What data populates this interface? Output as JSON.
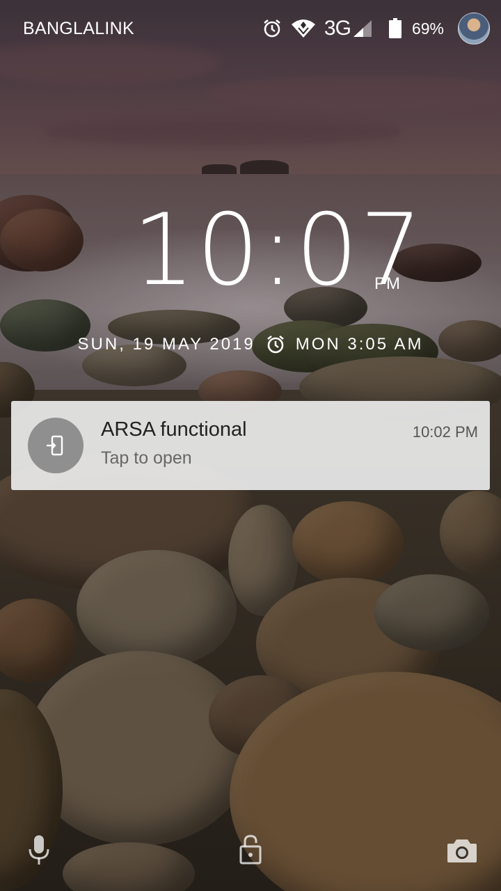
{
  "status_bar": {
    "carrier": "BANGLALINK",
    "network_type": "3G",
    "battery_percent": "69%",
    "icons": [
      "alarm-icon",
      "wifi-icon",
      "signal-icon",
      "battery-icon",
      "avatar"
    ]
  },
  "clock": {
    "time": "10:07",
    "ampm": "PM"
  },
  "date_row": {
    "date": "SUN, 19 MAY 2019",
    "next_alarm": "MON 3:05 AM"
  },
  "notification": {
    "title": "ARSA functional",
    "text": "Tap to open",
    "time": "10:02 PM",
    "icon": "device-enter-icon"
  },
  "bottom_bar": {
    "left": "microphone-icon",
    "center": "unlock-icon",
    "right": "camera-icon"
  }
}
